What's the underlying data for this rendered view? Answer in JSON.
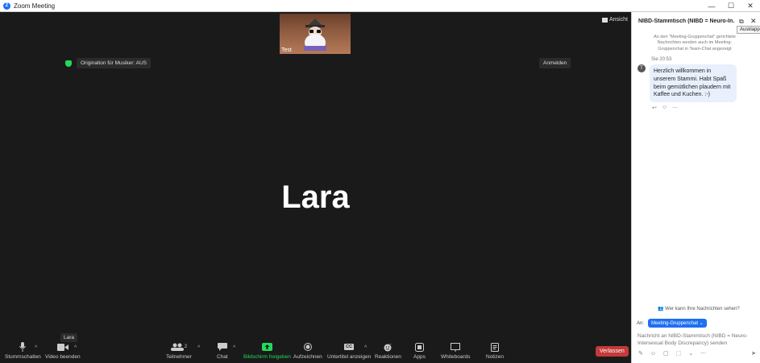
{
  "window": {
    "title": "Zoom Meeting",
    "controls": {
      "minimize": "—",
      "maximize": "☐",
      "close": "✕"
    }
  },
  "meeting": {
    "thumbnail_label": "Test",
    "view_label": "Ansicht",
    "original_sound": "Originalton für Musiker: AUS",
    "signin": "Anmelden",
    "active_name": "Lara",
    "tooltip": "Lara"
  },
  "toolbar": {
    "mute": "Stummschalten",
    "video": "Video beenden",
    "participants": "Teilnehmer",
    "participant_count": "2",
    "chat": "Chat",
    "share": "Bildschirm freigeben",
    "record": "Aufzeichnen",
    "captions": "Untertitel anzeigen",
    "captions_badge": "CC",
    "reactions": "Reaktionen",
    "apps": "Apps",
    "whiteboards": "Whiteboards",
    "notes": "Notizen",
    "leave": "Verlassen"
  },
  "chat": {
    "title": "NIBD-Stammtisch (NIBD = Neuro-In…",
    "collapse_tooltip": "Ausklappe",
    "note": "An den \"Meeting-Gruppenchat\" gerichtete Nachrichten werden auch im Meeting-Gruppenchat in Team-Chat angezeigt",
    "message": {
      "sender_initial": "T",
      "time": "Sie 20:53",
      "text": "Herzlich willkommen in unserem Stammi. Habt Spaß beim gemütlichen plaudern mit Kaffee und Kuchen. :-)"
    },
    "who_can_see": "Wer kann Ihre Nachrichten sehen?",
    "to_label": "An:",
    "to_value": "Meeting-Gruppenchat",
    "input_placeholder": "Nachricht an NIBD-Stammtisch (NIBD = Neuro-Intersexual Body Discrepancy) senden"
  }
}
